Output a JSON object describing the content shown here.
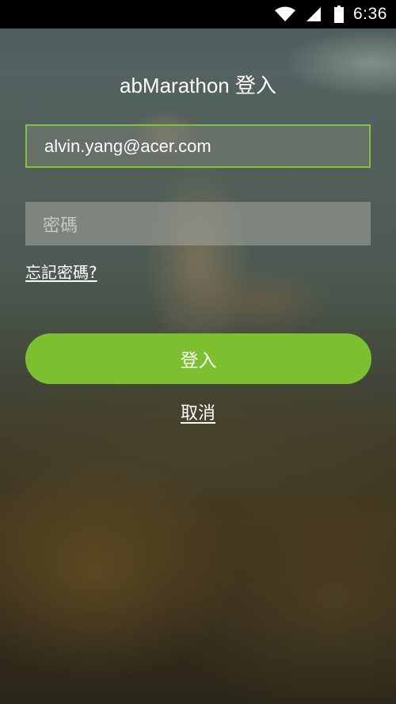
{
  "status_bar": {
    "time": "6:36",
    "icons": [
      "wifi-icon",
      "cell-signal-icon",
      "battery-icon"
    ]
  },
  "login": {
    "title": "abMarathon 登入",
    "email_value": "alvin.yang@acer.com",
    "password_placeholder": "密碼",
    "forgot_password": "忘記密碼?",
    "login_button": "登入",
    "cancel": "取消"
  },
  "colors": {
    "accent_green": "#7cbf2f",
    "email_border": "#7dc832",
    "status_bar": "#000000"
  }
}
